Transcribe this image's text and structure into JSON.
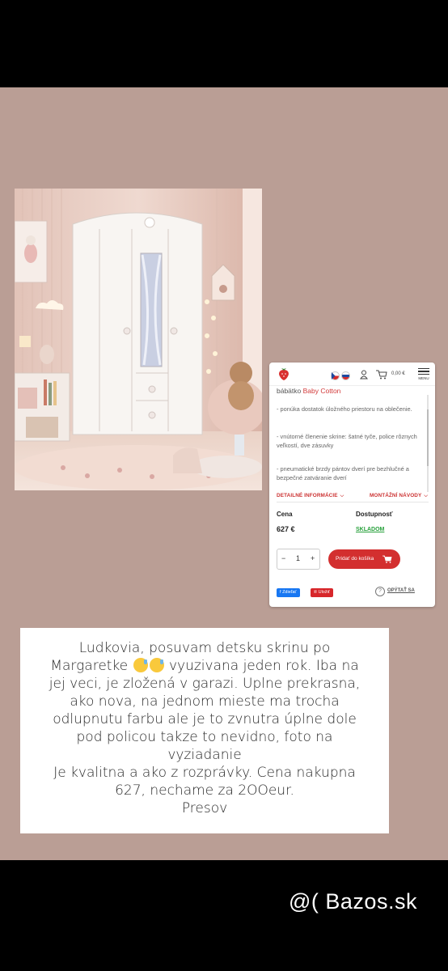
{
  "colors": {
    "panel_bg": "#ba9e95",
    "accent_red": "#d32f2f",
    "stock_green": "#26a03a",
    "facebook_blue": "#1877f2",
    "pinterest_red": "#d7262a"
  },
  "product_card": {
    "header": {
      "icons": [
        "strawberry-logo-icon",
        "czech-flag-icon",
        "slovak-flag-icon",
        "user-icon",
        "cart-icon",
        "hamburger-menu-icon"
      ],
      "cart_total": "0,00 €",
      "menu_label": "MENU"
    },
    "subtitle_prefix": "bábätko",
    "subtitle_brand": "Baby Cotton",
    "bullets": [
      "- ponúka dostatok úložného priestoru na oblečenie.",
      "- vnútorné členenie skrine: šatné tyče, police rôznych veľkostí, dve zásuvky",
      "- pneumatické brzdy pántov dverí pre bezhlučné a bezpečné zatváranie dverí"
    ],
    "tab_details": "DETAILNÉ INFORMÁCIE",
    "tab_assembly": "MONTÁŽNÍ NÁVODY",
    "price_label": "Cena",
    "availability_label": "Dostupnosť",
    "price": "627 €",
    "availability": "SKLADOM",
    "quantity": "1",
    "qty_minus": "−",
    "qty_plus": "+",
    "add_to_cart": "Pridať do košíka",
    "share_facebook": "Zdieľať",
    "share_pinterest": "Uložiť",
    "ask_link": "OPÝTAŤ SA"
  },
  "note": {
    "line1": "Ludkovia, posuvam detsku skrinu po",
    "line2_a": "Margaretke",
    "line2_b": "vyuzivana jeden rok. Iba na",
    "line3": "jej veci, je zložená v garazi. Uplne prekrasna,",
    "line4": "ako nova, na jednom mieste ma trocha",
    "line5": "odlupnutu farbu ale je to zvnutra úplne dole",
    "line6": "pod policou takze to nevidno, foto na",
    "line7": "vyziadanie",
    "line8": "Je kvalitna a ako z rozprávky. Cena nakupna",
    "line9": "627, nechame za 2OOeur.",
    "line10": "Presov",
    "emoji": "sad-but-relieved-face-emoji"
  },
  "watermark": "@( Bazos.sk"
}
